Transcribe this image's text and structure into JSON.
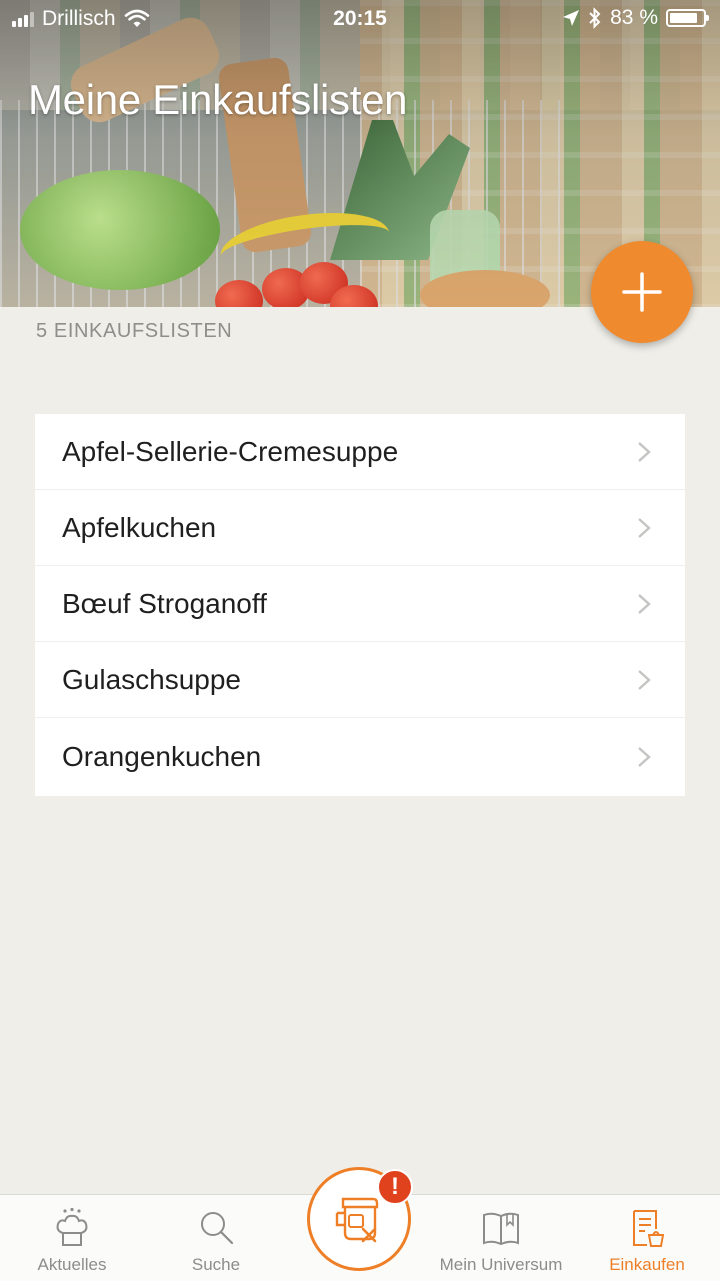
{
  "status_bar": {
    "carrier": "Drillisch",
    "time": "20:15",
    "battery_percent": "83 %",
    "battery_level": 0.83
  },
  "header": {
    "title": "Meine Einkaufslisten",
    "add_button_icon": "plus-icon"
  },
  "summary": {
    "count_label": "5 EINKAUFSLISTEN"
  },
  "lists": [
    {
      "label": "Apfel-Sellerie-Cremesuppe"
    },
    {
      "label": "Apfelkuchen"
    },
    {
      "label": "Bœuf Stroganoff"
    },
    {
      "label": "Gulaschsuppe"
    },
    {
      "label": "Orangenkuchen"
    }
  ],
  "tabbar": {
    "tabs": [
      {
        "label": "Aktuelles",
        "icon": "chef-hat-icon"
      },
      {
        "label": "Suche",
        "icon": "search-icon"
      },
      {
        "label": "Mein Universum",
        "icon": "book-icon"
      },
      {
        "label": "Einkaufen",
        "icon": "shopping-list-icon",
        "active": true
      }
    ],
    "center_icon": "thermomix-disconnected-icon",
    "badge": "!"
  },
  "colors": {
    "accent": "#ee7f26",
    "badge": "#e0421d",
    "background": "#efeee9"
  }
}
